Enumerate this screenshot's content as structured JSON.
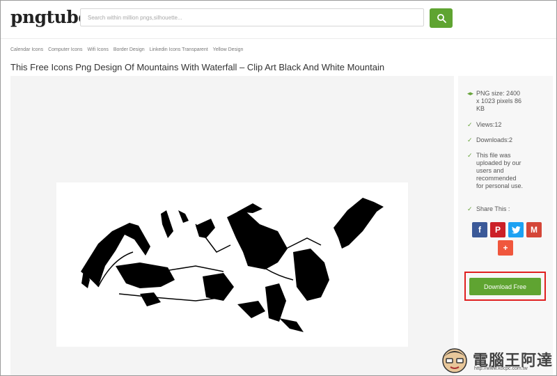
{
  "logo": "pngtube",
  "search": {
    "placeholder": "Search within million pngs,silhouette..."
  },
  "tags": [
    "Calendar Icons",
    "Computer Icons",
    "Wifi Icons",
    "Border Design",
    "Linkedin Icons Transparent",
    "Yellow Design"
  ],
  "title": "This Free Icons Png Design Of Mountains With Waterfall – Clip Art Black And White Mountain",
  "info": {
    "size_label": "PNG size: 2400 x 1023 pixels 86 KB",
    "views": "Views:12",
    "downloads": "Downloads:2",
    "note": "This file was uploaded by our users and recommended for personal use.",
    "share": "Share This :"
  },
  "share_buttons": [
    "facebook",
    "pinterest",
    "twitter",
    "gmail",
    "more"
  ],
  "download_label": "Download Free",
  "watermark": {
    "text": "電腦王阿達",
    "url": "http://www.kocpc.com.tw"
  },
  "colors": {
    "accent": "#5fa431",
    "highlight": "#e01f1f",
    "facebook": "#3b5998",
    "pinterest": "#cb2027",
    "twitter": "#1da1f2",
    "gmail": "#d44638",
    "more": "#f0573d"
  }
}
